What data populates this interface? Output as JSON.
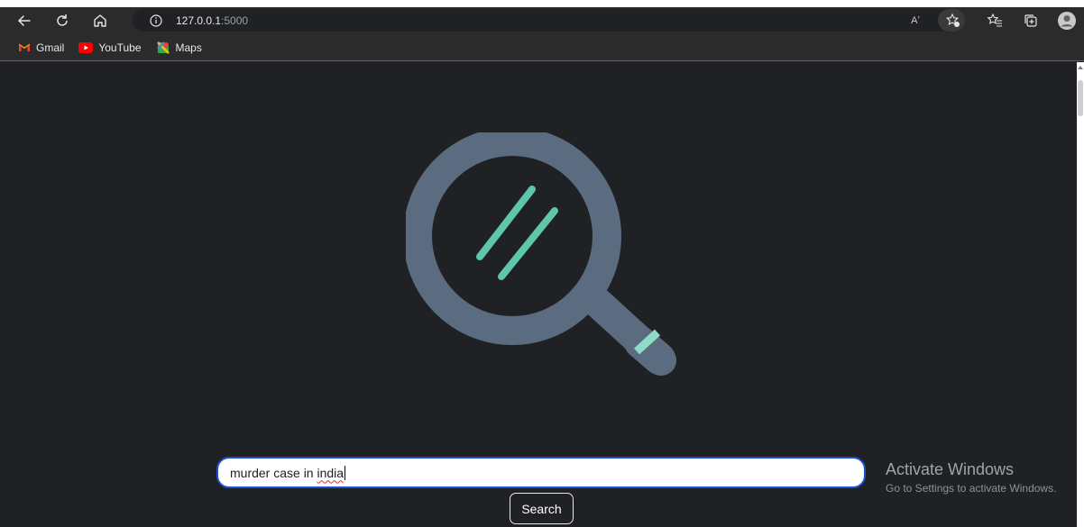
{
  "browser": {
    "url_host": "127.0.0.1",
    "url_port": ":5000",
    "read_aloud_label": "Aʼ",
    "icons": [
      "back-arrow-icon",
      "refresh-icon",
      "home-icon",
      "info-icon",
      "read-aloud-icon",
      "add-favorite-icon",
      "favorites-icon",
      "collections-icon",
      "profile-icon"
    ]
  },
  "bookmarks": [
    {
      "label": "Gmail",
      "icon": "gmail-icon"
    },
    {
      "label": "YouTube",
      "icon": "youtube-icon"
    },
    {
      "label": "Maps",
      "icon": "maps-icon"
    }
  ],
  "search": {
    "query_plain": "murder case in ",
    "query_misspelled": "india",
    "button_label": "Search"
  },
  "watermark": {
    "title": "Activate Windows",
    "subtitle": "Go to Settings to activate Windows."
  },
  "colors": {
    "page_bg": "#202124",
    "logo_ring": "#5b6c80",
    "logo_accent": "#5ec6aa",
    "input_border": "#1a4fd6"
  }
}
